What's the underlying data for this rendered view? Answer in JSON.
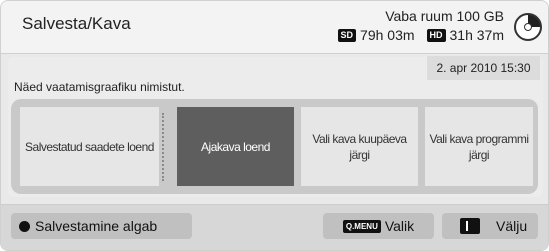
{
  "header": {
    "title": "Salvesta/Kava",
    "free_space": "Vaba ruum 100 GB",
    "sd_badge": "SD",
    "sd_time": "79h 03m",
    "hd_badge": "HD",
    "hd_time": "31h 37m"
  },
  "notice": "Näed vaatamisgraafiku nimistut.",
  "datetime": "2. apr 2010 15:30",
  "menu": {
    "items": [
      {
        "label": "Salvestatud saadete loend"
      },
      {
        "label": "Ajakava loend"
      },
      {
        "label": "Vali kava kuupäeva järgi"
      },
      {
        "label": "Vali kava programmi järgi"
      }
    ],
    "active_item": "Ajakava loend"
  },
  "footer": {
    "record_label": "Salvestamine algab",
    "menu_key": "Q.MENU",
    "select_label": "Valik",
    "exit_label": "Välju"
  }
}
